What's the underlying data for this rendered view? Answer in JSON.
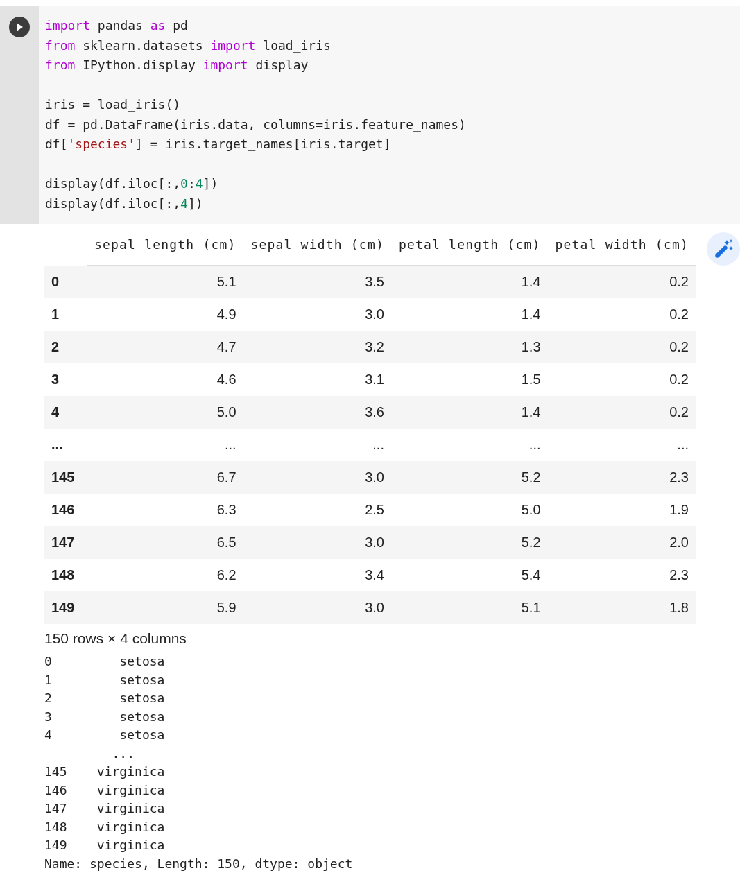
{
  "code_cell": {
    "blocks": [
      [
        {
          "tokens": [
            {
              "kind": "keyword",
              "text": "import"
            },
            {
              "kind": "plain",
              "text": " pandas "
            },
            {
              "kind": "keyword",
              "text": "as"
            },
            {
              "kind": "plain",
              "text": " pd"
            }
          ]
        },
        {
          "tokens": [
            {
              "kind": "keyword",
              "text": "from"
            },
            {
              "kind": "plain",
              "text": " sklearn.datasets "
            },
            {
              "kind": "keyword",
              "text": "import"
            },
            {
              "kind": "plain",
              "text": " load_iris"
            }
          ]
        },
        {
          "tokens": [
            {
              "kind": "keyword",
              "text": "from"
            },
            {
              "kind": "plain",
              "text": " IPython.display "
            },
            {
              "kind": "keyword",
              "text": "import"
            },
            {
              "kind": "plain",
              "text": " display"
            }
          ]
        }
      ],
      [
        {
          "tokens": [
            {
              "kind": "plain",
              "text": "iris = load_iris()"
            }
          ]
        },
        {
          "tokens": [
            {
              "kind": "plain",
              "text": "df = pd.DataFrame(iris.data, columns=iris.feature_names)"
            }
          ]
        },
        {
          "tokens": [
            {
              "kind": "plain",
              "text": "df["
            },
            {
              "kind": "string",
              "text": "'species'"
            },
            {
              "kind": "plain",
              "text": "] = iris.target_names[iris.target]"
            }
          ]
        }
      ],
      [
        {
          "tokens": [
            {
              "kind": "plain",
              "text": "display(df.iloc[:,"
            },
            {
              "kind": "number",
              "text": "0"
            },
            {
              "kind": "plain",
              "text": ":"
            },
            {
              "kind": "number",
              "text": "4"
            },
            {
              "kind": "plain",
              "text": "])"
            }
          ]
        },
        {
          "tokens": [
            {
              "kind": "plain",
              "text": "display(df.iloc[:,"
            },
            {
              "kind": "number",
              "text": "4"
            },
            {
              "kind": "plain",
              "text": "])"
            }
          ]
        }
      ]
    ]
  },
  "dataframe": {
    "columns": [
      "sepal length (cm)",
      "sepal width (cm)",
      "petal length (cm)",
      "petal width (cm)"
    ],
    "rows": [
      {
        "index": "0",
        "cells": [
          "5.1",
          "3.5",
          "1.4",
          "0.2"
        ]
      },
      {
        "index": "1",
        "cells": [
          "4.9",
          "3.0",
          "1.4",
          "0.2"
        ]
      },
      {
        "index": "2",
        "cells": [
          "4.7",
          "3.2",
          "1.3",
          "0.2"
        ]
      },
      {
        "index": "3",
        "cells": [
          "4.6",
          "3.1",
          "1.5",
          "0.2"
        ]
      },
      {
        "index": "4",
        "cells": [
          "5.0",
          "3.6",
          "1.4",
          "0.2"
        ]
      },
      {
        "index": "...",
        "cells": [
          "...",
          "...",
          "...",
          "..."
        ]
      },
      {
        "index": "145",
        "cells": [
          "6.7",
          "3.0",
          "5.2",
          "2.3"
        ]
      },
      {
        "index": "146",
        "cells": [
          "6.3",
          "2.5",
          "5.0",
          "1.9"
        ]
      },
      {
        "index": "147",
        "cells": [
          "6.5",
          "3.0",
          "5.2",
          "2.0"
        ]
      },
      {
        "index": "148",
        "cells": [
          "6.2",
          "3.4",
          "5.4",
          "2.3"
        ]
      },
      {
        "index": "149",
        "cells": [
          "5.9",
          "3.0",
          "5.1",
          "1.8"
        ]
      }
    ],
    "shape": "150 rows × 4 columns"
  },
  "series_output": [
    "0         setosa",
    "1         setosa",
    "2         setosa",
    "3         setosa",
    "4         setosa",
    "         ...",
    "145    virginica",
    "146    virginica",
    "147    virginica",
    "148    virginica",
    "149    virginica",
    "Name: species, Length: 150, dtype: object"
  ]
}
